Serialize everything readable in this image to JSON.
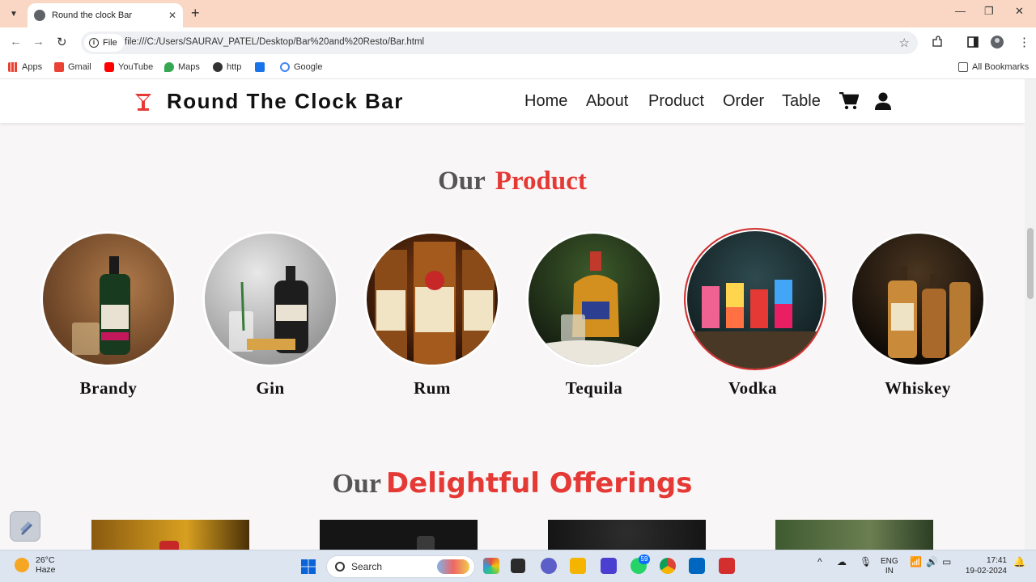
{
  "browser": {
    "tab_title": "Round the clock Bar",
    "file_chip": "File",
    "url": "file:///C:/Users/SAURAV_PATEL/Desktop/Bar%20and%20Resto/Bar.html",
    "bookmarks": [
      "Apps",
      "Gmail",
      "YouTube",
      "Maps",
      "http",
      "Google"
    ],
    "all_bookmarks": "All Bookmarks"
  },
  "site": {
    "brand": "Round The Clock Bar",
    "nav": [
      "Home",
      "About",
      "Product",
      "Order",
      "Table"
    ],
    "accent": "#e53935"
  },
  "products_section": {
    "title_a": "Our",
    "title_b": "Product",
    "items": [
      "Brandy",
      "Gin",
      "Rum",
      "Tequila",
      "Vodka",
      "Whiskey"
    ]
  },
  "offerings_section": {
    "title_a": "Our",
    "title_b": "Delightful Offerings"
  },
  "taskbar": {
    "temp": "26°C",
    "weather": "Haze",
    "search": "Search",
    "whatsapp_badge": "59",
    "lang_a": "ENG",
    "lang_b": "IN",
    "time": "17:41",
    "date": "19-02-2024"
  }
}
